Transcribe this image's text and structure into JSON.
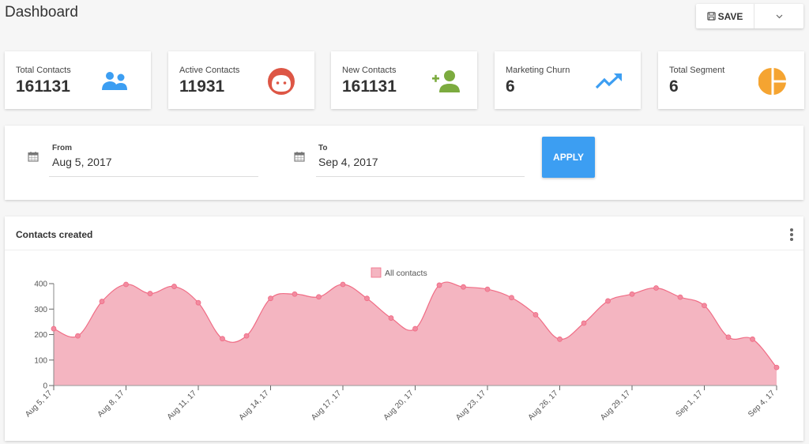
{
  "header": {
    "title": "Dashboard",
    "save_label": "SAVE",
    "save_icon": "floppy-disk-icon",
    "more_icon": "chevron-down-icon"
  },
  "stats": [
    {
      "label": "Total Contacts",
      "value": "161131",
      "icon": "people-icon",
      "color": "#3c9ef2"
    },
    {
      "label": "Active Contacts",
      "value": "11931",
      "icon": "face-icon",
      "color": "#dd5645"
    },
    {
      "label": "New Contacts",
      "value": "161131",
      "icon": "add-person-icon",
      "color": "#7cab3f"
    },
    {
      "label": "Marketing Churn",
      "value": "6",
      "icon": "trending-up-icon",
      "color": "#3c9ef2"
    },
    {
      "label": "Total Segment",
      "value": "6",
      "icon": "pie-chart-icon",
      "color": "#f5a431"
    }
  ],
  "filter": {
    "from_label": "From",
    "from_value": "Aug 5, 2017",
    "to_label": "To",
    "to_value": "Sep 4, 2017",
    "apply_label": "APPLY"
  },
  "chart_card": {
    "title": "Contacts created",
    "menu_icon": "kebab-menu-icon"
  },
  "chart_data": {
    "type": "area",
    "title": "Contacts created",
    "legend": [
      "All contacts"
    ],
    "legend_position": "top-center",
    "xlabel": "",
    "ylabel": "",
    "ylim": [
      0,
      400
    ],
    "yticks": [
      0,
      100,
      200,
      300,
      400
    ],
    "xtick_labels": [
      "Aug 5, 17",
      "Aug 8, 17",
      "Aug 11, 17",
      "Aug 14, 17",
      "Aug 17, 17",
      "Aug 20, 17",
      "Aug 23, 17",
      "Aug 26, 17",
      "Aug 29, 17",
      "Sep 1, 17",
      "Sep 4, 17"
    ],
    "xtick_every": 3,
    "grid": false,
    "color": "#f06c85",
    "fill": "#f4b5c1",
    "series": [
      {
        "name": "All contacts",
        "values": [
          223,
          195,
          330,
          397,
          361,
          389,
          325,
          184,
          195,
          342,
          359,
          348,
          397,
          342,
          265,
          223,
          394,
          387,
          378,
          345,
          278,
          182,
          245,
          332,
          359,
          383,
          347,
          314,
          190,
          182,
          71
        ]
      }
    ]
  }
}
